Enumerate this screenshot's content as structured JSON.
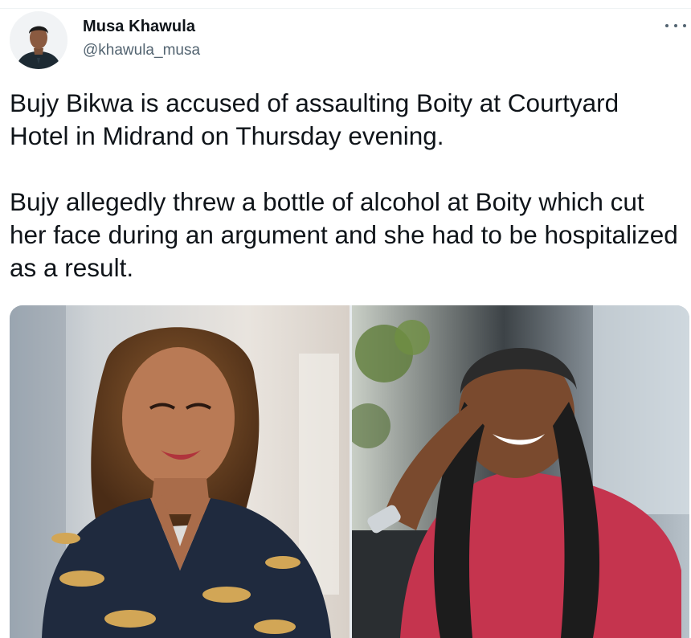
{
  "tweet": {
    "author": {
      "display_name": "Musa Khawula",
      "handle": "@khawula_musa",
      "avatar_icon": "profile-photo"
    },
    "more_icon": "more-horizontal-icon",
    "text_paragraphs": [
      "Bujy Bikwa is accused of assaulting Boity at Courtyard Hotel in Midrand on Thursday evening.",
      "Bujy allegedly threw a bottle of alcohol at Boity which cut her face during an argument and she had to be hospitalized as a result."
    ],
    "media": [
      {
        "description_icon": "photo-woman-leopard-print-shirt"
      },
      {
        "description_icon": "photo-man-braids-red-shirt"
      }
    ]
  },
  "colors": {
    "text_primary": "#0f1419",
    "text_secondary": "#536471",
    "divider": "#eff3f4"
  }
}
